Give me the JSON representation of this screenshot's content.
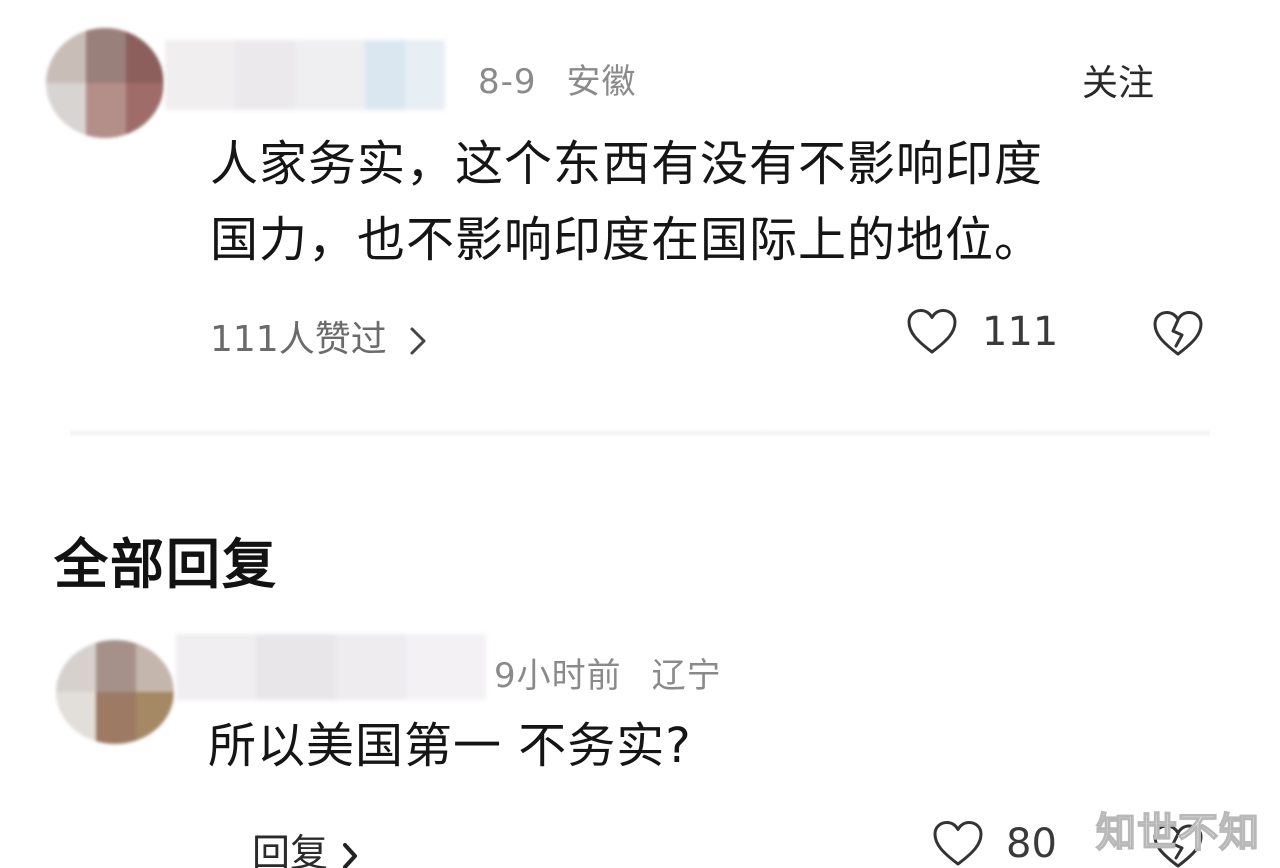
{
  "comment": {
    "date": "8-9",
    "location": "安徽",
    "follow_label": "关注",
    "text_line1": "人家务实，这个东西有没有不影响印度",
    "text_line2": "国力，也不影响印度在国际上的地位。",
    "likers_label": "111人赞过",
    "like_count": "111"
  },
  "replies_section": {
    "title": "全部回复"
  },
  "reply": {
    "time": "9小时前",
    "location": "辽宁",
    "text": "所以美国第一 不务实?",
    "reply_label": "回复",
    "like_count": "80"
  },
  "watermark": "知世不知",
  "icons": {
    "heart": "heart-outline-icon",
    "broken_heart": "broken-heart-icon",
    "chevron": "chevron-right-icon"
  }
}
